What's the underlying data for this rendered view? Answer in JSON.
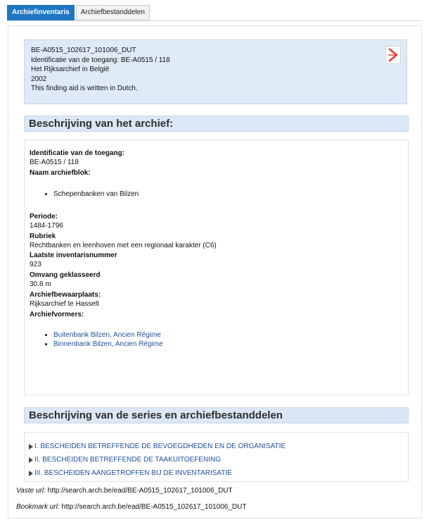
{
  "tabs": [
    "Archiefinventaris",
    "Archiefbestanddelen"
  ],
  "summary": {
    "lines": [
      "BE-A0515_102617_101006_DUT",
      "Identificatie van de toegang: BE-A0515 / 118",
      "Het Rijksarchief in België",
      "2002",
      "This finding aid is written in Dutch."
    ],
    "pdf_icon": "pdf-icon"
  },
  "description": {
    "heading": "Beschrijving van het archief:",
    "identification_label": "Identificatie van de toegang:",
    "identification_value": "BE-A0515 / 118",
    "name_label": "Naam archiefblok:",
    "name_items": [
      "Schepenbanken van Bilzen"
    ],
    "period_label": "Periode:",
    "period_value": "1484-1796",
    "rubric_label": "Rubriek",
    "rubric_value": "Rechtbanken en leenhoven met een regionaal karakter (C6)",
    "last_inv_label": "Laatste inventarisnummer",
    "last_inv_value": "923",
    "extent_label": "Omvang geklasseerd",
    "extent_value": "30.8 m",
    "repository_label": "Archiefbewaarplaats:",
    "repository_value": "Rijksarchief te Hasselt",
    "creators_label": "Archiefvormers:",
    "creators": [
      "Buitenbank Bilzen, Ancien Régime",
      "Binnenbank Bilzen, Ancien Régime"
    ]
  },
  "series": {
    "heading": "Beschrijving van de series en archiefbestanddelen",
    "items": [
      "I. BESCHEIDEN BETREFFENDE DE BEVOEGDHEDEN EN DE ORGANISATIE",
      "II. BESCHEIDEN BETREFFENDE DE TAAKUITOEFENING",
      "III. BESCHEIDEN AANGETROFFEN BIJ DE INVENTARISATIE"
    ]
  },
  "footer": {
    "vaste_label": "Vaste url:",
    "vaste_url": "http://search.arch.be/ead/BE-A0515_102617_101006_DUT",
    "bookmark_label": "Bookmark url:",
    "bookmark_url": "http://search.arch.be/ead/BE-A0515_102617_101006_DUT"
  },
  "colors": {
    "accent": "#1f77c3",
    "link": "#1d4f9a",
    "summary_bg": "#deebf7",
    "heading_bg": "#dbe7f4"
  }
}
